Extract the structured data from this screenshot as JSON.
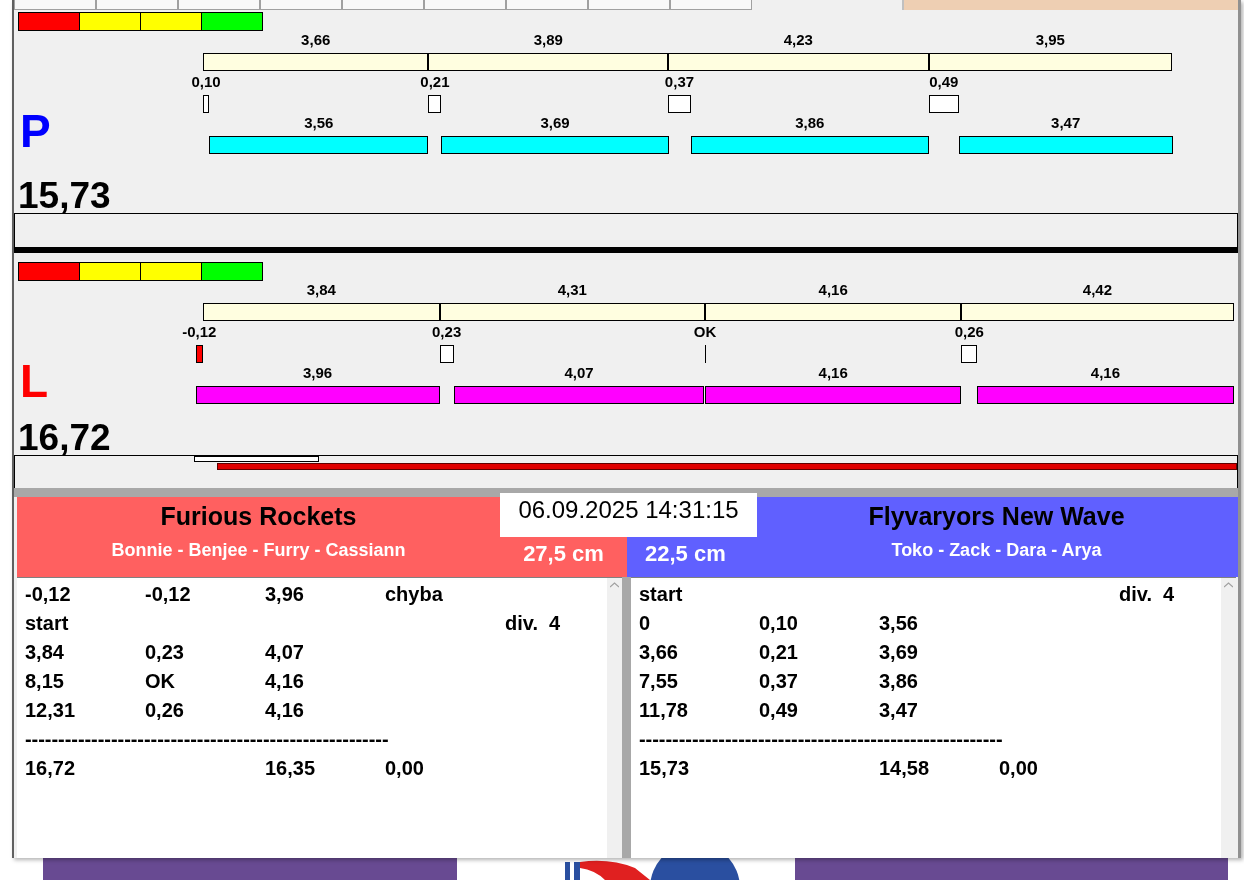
{
  "lanes": [
    {
      "letter": "P",
      "color": "#0000ff",
      "total": "15,73",
      "scale": [
        {
          "color": "#ff0000"
        },
        {
          "color": "#ffff00"
        },
        {
          "color": "#ffff00"
        },
        {
          "color": "#00ff00"
        }
      ],
      "splits": [
        "3,66",
        "3,89",
        "4,23",
        "3,95"
      ],
      "reactions": [
        {
          "kind": "positive",
          "text": "0,10"
        },
        {
          "kind": "positive",
          "text": "0,21"
        },
        {
          "kind": "positive",
          "text": "0,37"
        },
        {
          "kind": "positive",
          "text": "0,49"
        }
      ],
      "legs": [
        {
          "text": "3,56",
          "color": "#00ffff"
        },
        {
          "text": "3,69",
          "color": "#00ffff"
        },
        {
          "text": "3,86",
          "color": "#00ffff"
        },
        {
          "text": "3,47",
          "color": "#00ffff"
        }
      ]
    },
    {
      "letter": "L",
      "color": "#ff0000",
      "total": "16,72",
      "scale": [
        {
          "color": "#ff0000"
        },
        {
          "color": "#ffff00"
        },
        {
          "color": "#ffff00"
        },
        {
          "color": "#00ff00"
        }
      ],
      "splits": [
        "3,84",
        "4,31",
        "4,16",
        "4,42"
      ],
      "reactions": [
        {
          "kind": "negative",
          "text": "-0,12"
        },
        {
          "kind": "positive",
          "text": "0,23"
        },
        {
          "kind": "zero",
          "text": "OK"
        },
        {
          "kind": "positive",
          "text": "0,26"
        }
      ],
      "legs": [
        {
          "text": "3,96",
          "color": "#ff00ff"
        },
        {
          "text": "4,07",
          "color": "#ff00ff"
        },
        {
          "text": "4,16",
          "color": "#ff00ff"
        },
        {
          "text": "4,16",
          "color": "#ff00ff"
        }
      ]
    }
  ],
  "progress": {
    "level": 0.835
  },
  "timestamp": "06.09.2025 14:31:15",
  "teams": [
    {
      "name": "Furious Rockets",
      "members": "Bonnie - Benjee - Furry - Cassiann",
      "distance": "27,5 cm",
      "color": "#ff6060",
      "results": [
        {
          "kind": "data",
          "cells": [
            "-0,12",
            "-0,12",
            "3,96",
            "chyba"
          ]
        },
        {
          "kind": "start",
          "label": "start",
          "division": "div.  4"
        },
        {
          "kind": "data",
          "cells": [
            "3,84",
            "0,23",
            "4,07"
          ]
        },
        {
          "kind": "data",
          "cells": [
            "8,15",
            "OK",
            "4,16"
          ]
        },
        {
          "kind": "data",
          "cells": [
            "12,31",
            "0,26",
            "4,16"
          ]
        },
        {
          "kind": "rule",
          "text": "-------------------------------------------------------"
        },
        {
          "kind": "total",
          "cells": [
            "16,72",
            "16,35",
            "0,00"
          ]
        }
      ]
    },
    {
      "name": "Flyvaryors New Wave",
      "members": "Toko - Zack - Dara - Arya",
      "distance": "22,5 cm",
      "color": "#6060ff",
      "results": [
        {
          "kind": "start",
          "label": "start",
          "division": "div.  4"
        },
        {
          "kind": "data",
          "cells": [
            "0",
            "0,10",
            "3,56"
          ]
        },
        {
          "kind": "data",
          "cells": [
            "3,66",
            "0,21",
            "3,69"
          ]
        },
        {
          "kind": "data",
          "cells": [
            "7,55",
            "0,37",
            "3,86"
          ]
        },
        {
          "kind": "data",
          "cells": [
            "11,78",
            "0,49",
            "3,47"
          ]
        },
        {
          "kind": "rule",
          "text": "-------------------------------------------------------"
        },
        {
          "kind": "total",
          "cells": [
            "15,73",
            "14,58",
            "0,00"
          ]
        }
      ]
    }
  ]
}
